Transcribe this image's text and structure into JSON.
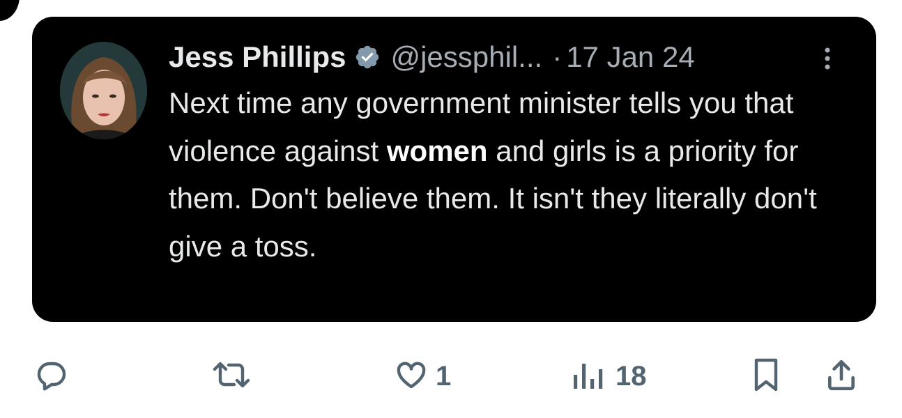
{
  "quoted_tweet": {
    "author_name": "Jess Phillips",
    "handle": "@jessphil...",
    "separator": "·",
    "date": "17 Jan 24",
    "text_before_bold": "Next time any government minister tells you that violence against ",
    "text_bold": "women",
    "text_after_bold": " and girls is a priority for them. Don't believe them. It isn't they literally don't give a toss."
  },
  "actions": {
    "reply_icon": "reply-icon",
    "retweet_icon": "retweet-icon",
    "like_icon": "heart-icon",
    "like_count": "1",
    "views_icon": "views-icon",
    "views_count": "18",
    "bookmark_icon": "bookmark-icon",
    "share_icon": "share-icon"
  },
  "colors": {
    "card_bg": "#000000",
    "text": "#e7e9ea",
    "muted": "#a6adb4",
    "action_gray": "#536471"
  }
}
